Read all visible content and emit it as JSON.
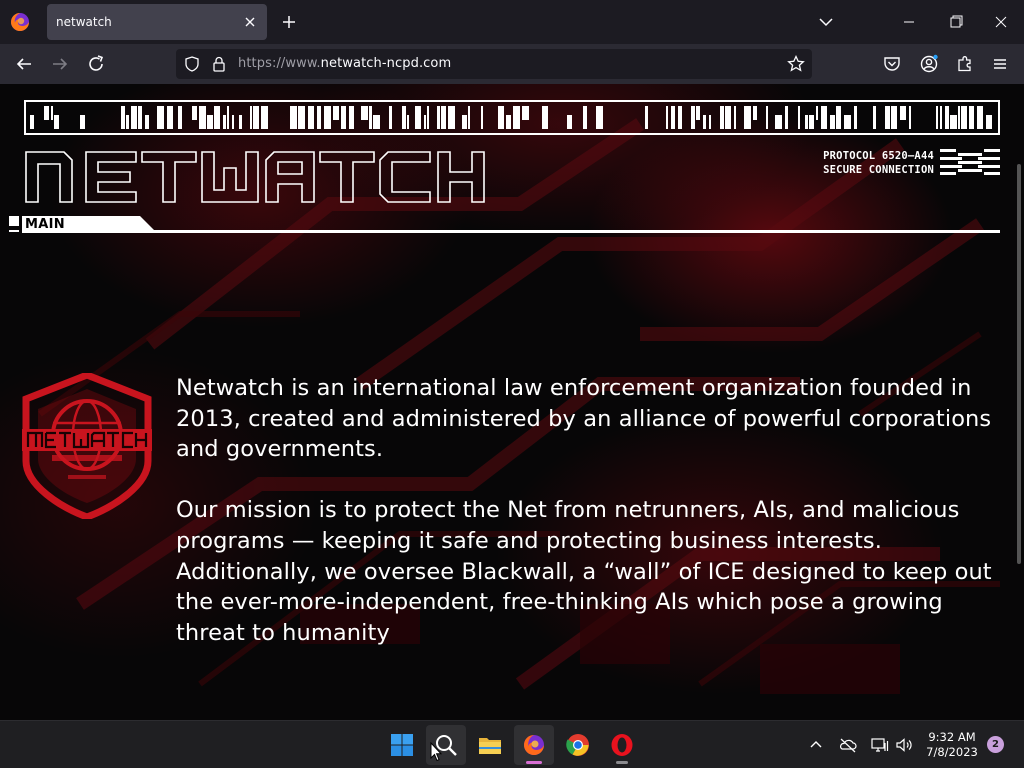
{
  "browser": {
    "tab_title": "netwatch",
    "url_prefix": "https://www.",
    "url_domain": "netwatch-ncpd.com",
    "accent": "#d86fd4"
  },
  "page": {
    "logo_wordmark": "NETWATCH",
    "protocol_line1": "PROTOCOL 6520—A44",
    "protocol_line2": "SECURE CONNECTION",
    "section_label": "MAIN",
    "badge_text": "NETWATCH",
    "paragraphs": [
      "Netwatch is an international law enforcement organization founded in 2013, created and administered by an alliance of powerful corporations and governments.",
      "Our mission is to protect the Net from netrunners, AIs, and malicious programs — keeping it safe and protecting business interests. Additionally, we oversee Blackwall, a “wall” of ICE designed to keep out the ever-more-independent, free-thinking AIs which pose a growing threat to humanity"
    ],
    "accent_red": "#c8141e"
  },
  "taskbar": {
    "apps": [
      "start-icon",
      "search-icon",
      "file-explorer-icon",
      "firefox-icon",
      "chrome-icon",
      "opera-icon"
    ],
    "time": "9:32 AM",
    "date": "7/8/2023",
    "notification_count": "2"
  }
}
